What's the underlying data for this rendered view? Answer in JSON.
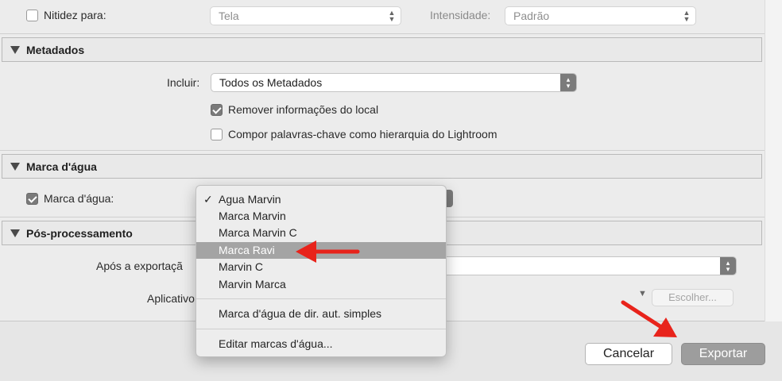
{
  "sharpen": {
    "checkbox_label": "Nitidez para:",
    "checked": false,
    "target_value": "Tela",
    "amount_label": "Intensidade:",
    "amount_value": "Padrão"
  },
  "metadata": {
    "section_title": "Metadados",
    "include_label": "Incluir:",
    "include_value": "Todos os Metadados",
    "remove_location_label": "Remover informações do local",
    "remove_location_checked": true,
    "hierarchy_label": "Compor palavras-chave como hierarquia do Lightroom",
    "hierarchy_checked": false
  },
  "watermark": {
    "section_title": "Marca d'água",
    "checkbox_label": "Marca d'água:",
    "checked": true
  },
  "post_processing": {
    "section_title": "Pós-processamento",
    "after_export_label": "Após a exportaçã",
    "application_label": "Aplicativo",
    "choose_button": "Escolher..."
  },
  "dropdown_menu": {
    "check_mark": "✓",
    "items": [
      {
        "label": "Agua Marvin",
        "checked": true
      },
      {
        "label": "Marca Marvin"
      },
      {
        "label": "Marca Marvin C"
      },
      {
        "label": "Marca Ravi",
        "highlighted": true
      },
      {
        "label": "Marvin C"
      },
      {
        "label": "Marvin Marca"
      }
    ],
    "simple_copyright": "Marca d'água de dir. aut. simples",
    "edit_watermarks": "Editar marcas d'água..."
  },
  "footer": {
    "cancel_label": "Cancelar",
    "export_label": "Exportar"
  },
  "colors": {
    "annotation_arrow": "#e8231b",
    "menu_highlight": "#a4a4a4"
  }
}
